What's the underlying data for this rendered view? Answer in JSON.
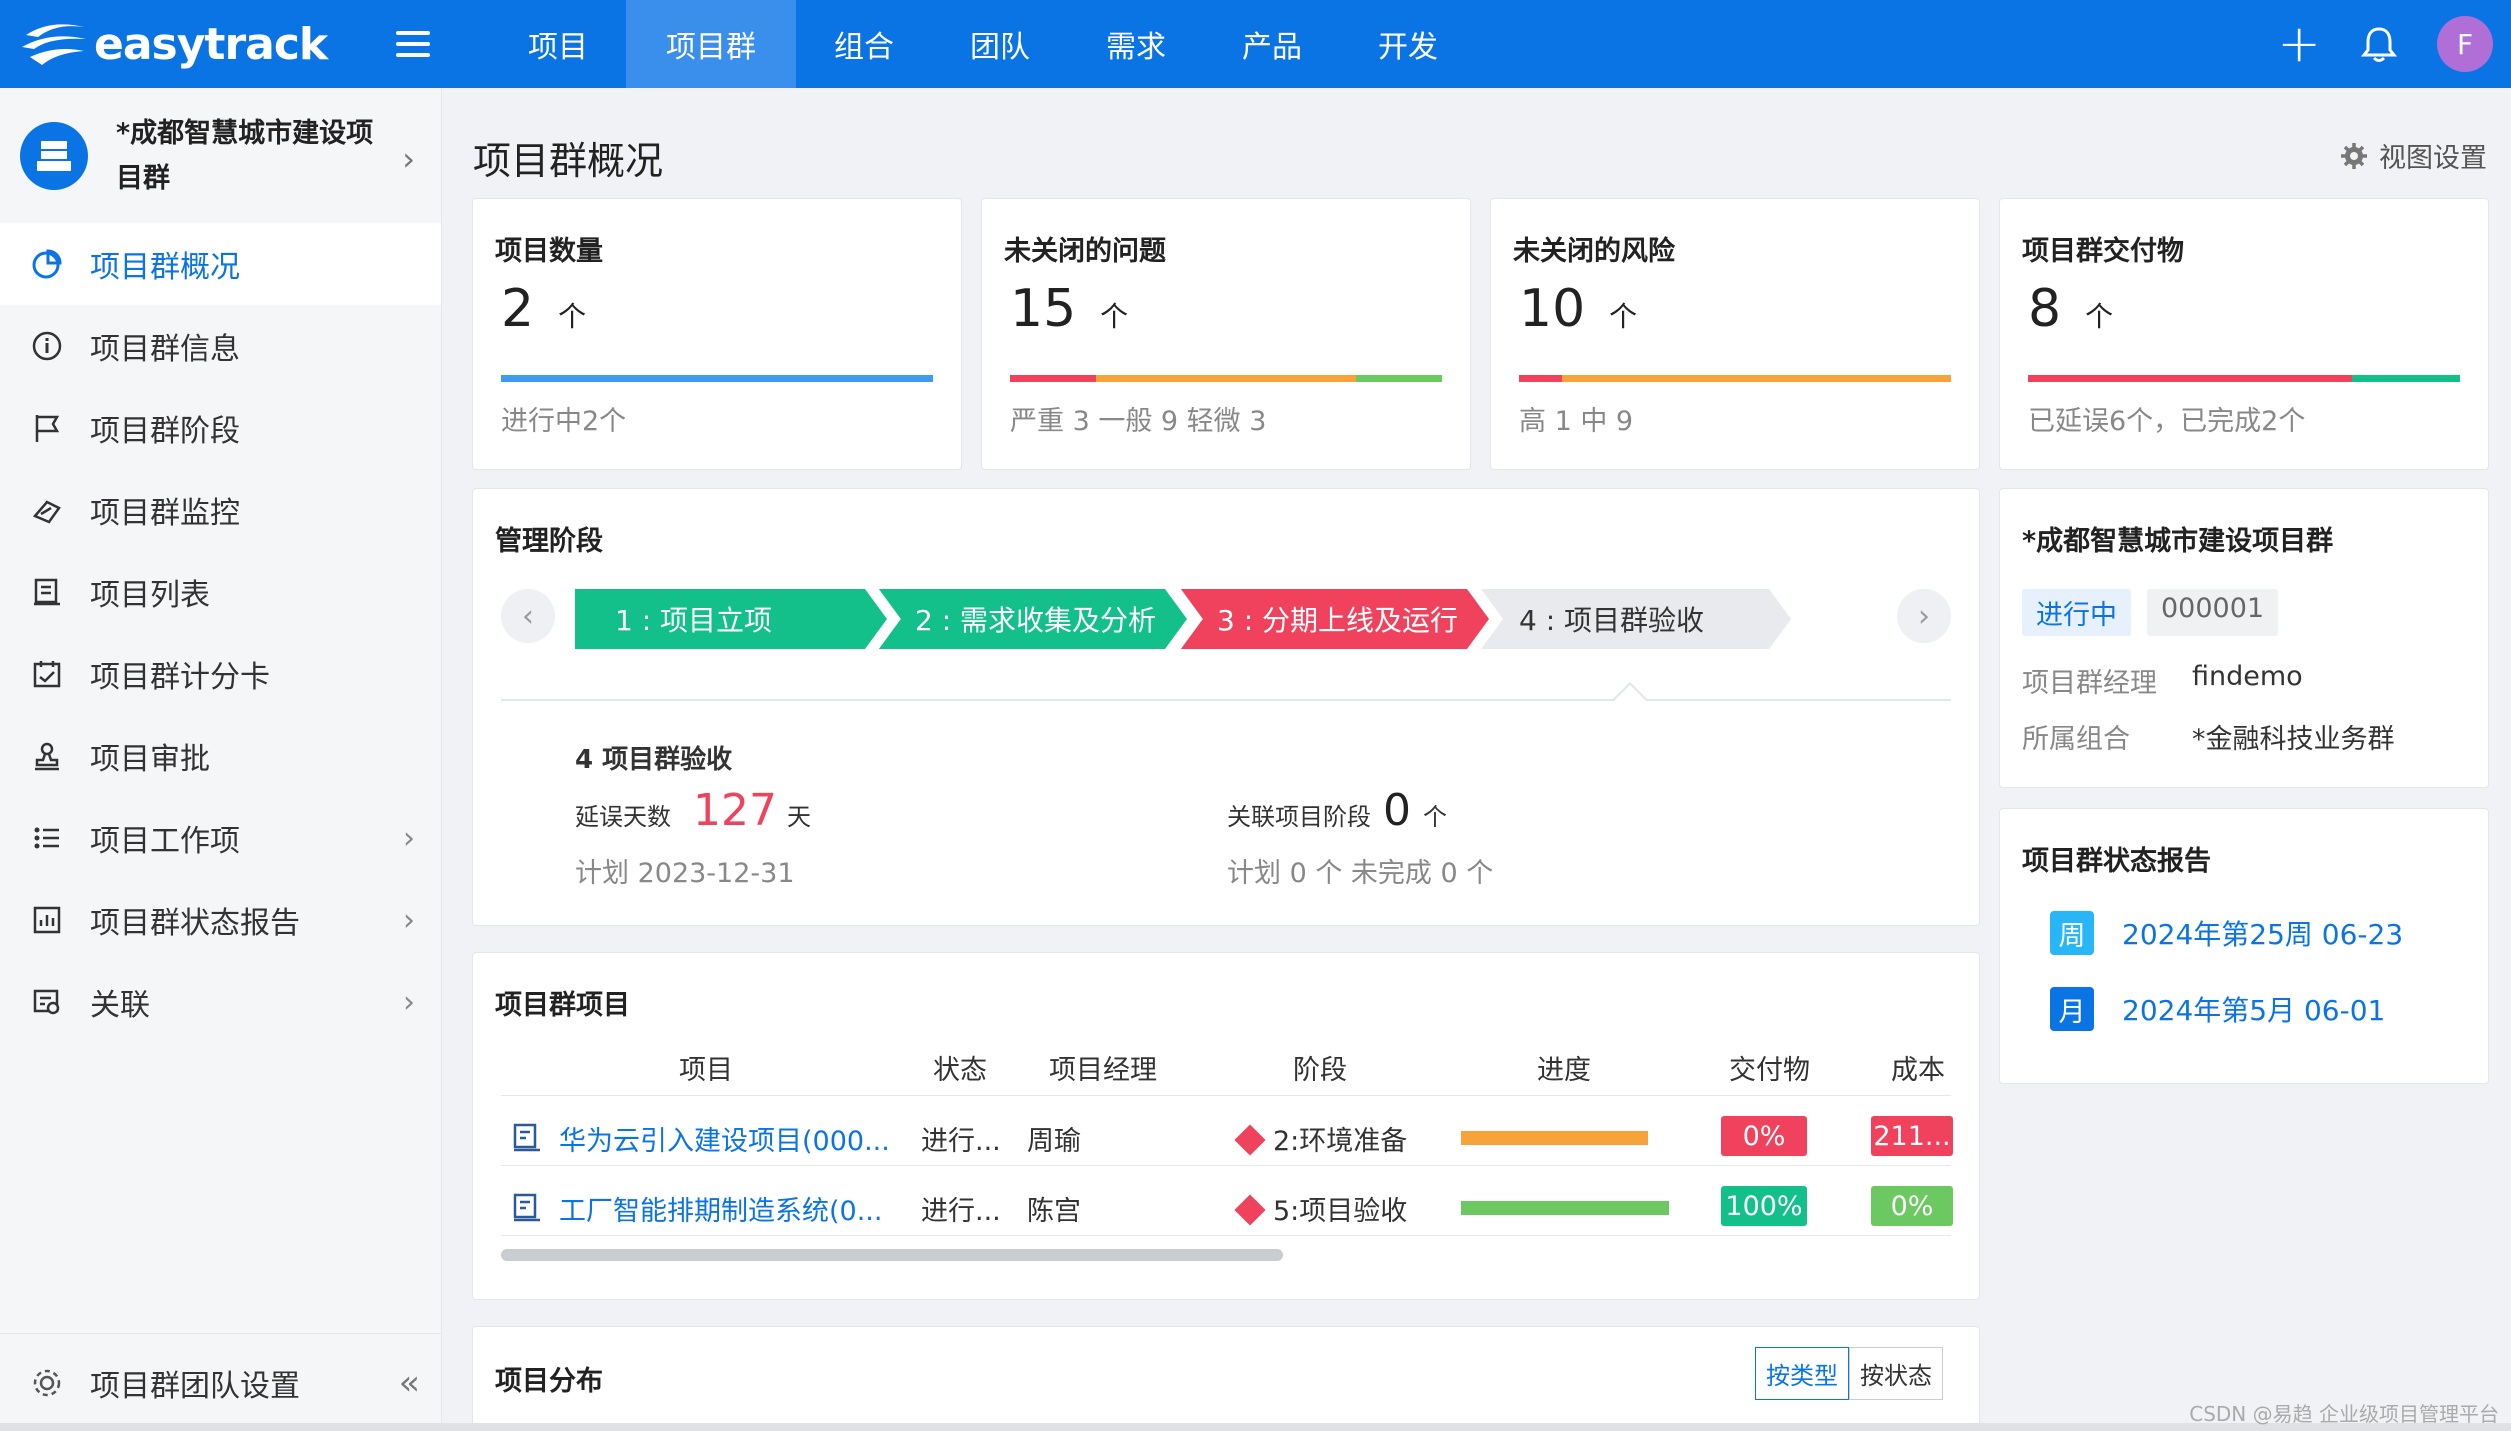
{
  "app": {
    "logo_text": "easytrack",
    "accent": "#0b74e5"
  },
  "nav": [
    "项目",
    "项目群",
    "组合",
    "团队",
    "需求",
    "产品",
    "开发"
  ],
  "nav_active": 1,
  "user": {
    "avatar_letter": "F"
  },
  "sidebar": {
    "title": "*成都智慧城市建设项目群",
    "items": [
      {
        "label": "项目群概况",
        "icon": "pie-chart-icon"
      },
      {
        "label": "项目群信息",
        "icon": "info-icon"
      },
      {
        "label": "项目群阶段",
        "icon": "flag-icon"
      },
      {
        "label": "项目群监控",
        "icon": "monitor-icon"
      },
      {
        "label": "项目列表",
        "icon": "list-icon"
      },
      {
        "label": "项目群计分卡",
        "icon": "scorecard-icon"
      },
      {
        "label": "项目审批",
        "icon": "stamp-icon"
      },
      {
        "label": "项目工作项",
        "icon": "task-list-icon"
      },
      {
        "label": "项目群状态报告",
        "icon": "report-icon"
      },
      {
        "label": "关联",
        "icon": "link-icon"
      }
    ],
    "footer_label": "项目群团队设置"
  },
  "page": {
    "title": "项目群概况",
    "view_settings": "视图设置"
  },
  "stats": [
    {
      "title": "项目数量",
      "value": "2",
      "unit": "个",
      "sub": "进行中2个"
    },
    {
      "title": "未关闭的问题",
      "value": "15",
      "unit": "个",
      "sub": "严重 3 一般 9 轻微 3"
    },
    {
      "title": "未关闭的风险",
      "value": "10",
      "unit": "个",
      "sub": "高 1 中 9"
    },
    {
      "title": "项目群交付物",
      "value": "8",
      "unit": "个",
      "sub": "已延误6个，已完成2个"
    }
  ],
  "stages": {
    "title": "管理阶段",
    "items": [
      {
        "label": "1 : 项目立项",
        "color": "#13c08a"
      },
      {
        "label": "2 : 需求收集及分析",
        "color": "#13c08a"
      },
      {
        "label": "3 : 分期上线及运行",
        "color": "#f0425c"
      },
      {
        "label": "4 : 项目群验收",
        "color": "#e8eaed"
      }
    ],
    "detail": {
      "title": "4 项目群验收",
      "delay_label": "延误天数",
      "delay_value": "127",
      "delay_unit": "天",
      "plan": "计划 2023-12-31",
      "linked_label": "关联项目阶段",
      "linked_value": "0",
      "linked_unit": "个",
      "linked_sub": "计划 0 个  未完成  0 个"
    }
  },
  "projects": {
    "title": "项目群项目",
    "headers": [
      "项目",
      "状态",
      "项目经理",
      "阶段",
      "进度",
      "交付物",
      "成本"
    ],
    "rows": [
      {
        "name": "华为云引入建设项目(000...",
        "status": "进行...",
        "manager": "周瑜",
        "stage": "2:环境准备",
        "progress": 0.9,
        "progress_color": "#f7a23b",
        "deliverable": "0%",
        "deliverable_color": "#f0425c",
        "cost": "211...",
        "cost_color": "#f0425c"
      },
      {
        "name": "工厂智能排期制造系统(0...",
        "status": "进行...",
        "manager": "陈宫",
        "stage": "5:项目验收",
        "progress": 1.0,
        "progress_color": "#6cc860",
        "deliverable": "100%",
        "deliverable_color": "#13c08a",
        "cost": "0%",
        "cost_color": "#6cc860"
      }
    ]
  },
  "distribution": {
    "title": "项目分布",
    "toggle": [
      "按类型",
      "按状态"
    ]
  },
  "info_card": {
    "title": "*成都智慧城市建设项目群",
    "status": "进行中",
    "code": "000001",
    "manager_label": "项目群经理",
    "manager": "findemo",
    "portfolio_label": "所属组合",
    "portfolio": "*金融科技业务群"
  },
  "reports": {
    "title": "项目群状态报告",
    "items": [
      {
        "icon_text": "周",
        "text": "2024年第25周  06-23",
        "color": "#29b6f6"
      },
      {
        "icon_text": "月",
        "text": "2024年第5月  06-01",
        "color": "#0b74e5"
      }
    ]
  },
  "watermark": "CSDN @易趋 企业级项目管理平台"
}
